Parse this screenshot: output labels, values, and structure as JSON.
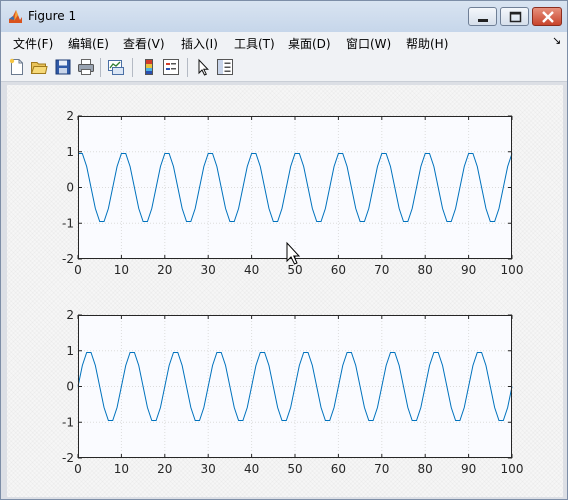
{
  "window": {
    "title": "Figure 1",
    "controls": {
      "minimize": "minimize",
      "maximize": "maximize",
      "close": "close"
    }
  },
  "menu": {
    "items": [
      {
        "label": "文件(F)"
      },
      {
        "label": "编辑(E)"
      },
      {
        "label": "查看(V)"
      },
      {
        "label": "插入(I)"
      },
      {
        "label": "工具(T)"
      },
      {
        "label": "桌面(D)"
      },
      {
        "label": "窗口(W)"
      },
      {
        "label": "帮助(H)"
      }
    ],
    "overflow_glyph": "↘"
  },
  "toolbar": {
    "icons": [
      "new-file-icon",
      "open-folder-icon",
      "save-icon",
      "print-icon",
      "link-plot-icon",
      "colorbar-icon",
      "legend-icon",
      "select-arrow-icon",
      "property-editor-icon"
    ]
  },
  "colors": {
    "line": "#0072bd",
    "axes_bg": "#fafbff",
    "grid": "#dcdcdc"
  },
  "chart_data": [
    {
      "type": "line",
      "x_range": [
        0,
        100
      ],
      "ylim": [
        -2,
        2
      ],
      "x_ticks": [
        "0",
        "10",
        "20",
        "30",
        "40",
        "50",
        "60",
        "70",
        "80",
        "90",
        "100"
      ],
      "y_ticks": [
        "2",
        "1",
        "0",
        "-1",
        "-2"
      ],
      "grid": true,
      "title": "",
      "xlabel": "",
      "ylabel": "",
      "series": [
        {
          "function": "cos(2*pi*(x-0.5)/10)",
          "x": [
            0,
            1,
            2,
            3,
            4,
            5,
            6,
            7,
            8,
            9,
            10
          ],
          "y": [
            0.81,
            0.31,
            -0.31,
            -0.81,
            -1.0,
            -0.81,
            -0.31,
            0.31,
            0.81,
            1.0,
            0.81
          ]
        }
      ]
    },
    {
      "type": "line",
      "x_range": [
        0,
        100
      ],
      "ylim": [
        -2,
        2
      ],
      "x_ticks": [
        "0",
        "10",
        "20",
        "30",
        "40",
        "50",
        "60",
        "70",
        "80",
        "90",
        "100"
      ],
      "y_ticks": [
        "2",
        "1",
        "0",
        "-1",
        "-2"
      ],
      "grid": true,
      "title": "",
      "xlabel": "",
      "ylabel": "",
      "series": [
        {
          "function": "cos(2*pi*(x-2.5)/10)",
          "x": [
            0,
            1,
            2,
            3,
            4,
            5,
            6,
            7,
            8,
            9,
            10
          ],
          "y": [
            0.0,
            0.59,
            0.95,
            0.95,
            0.59,
            0.0,
            -0.59,
            -0.95,
            -0.95,
            -0.59,
            0.0
          ]
        }
      ]
    }
  ]
}
